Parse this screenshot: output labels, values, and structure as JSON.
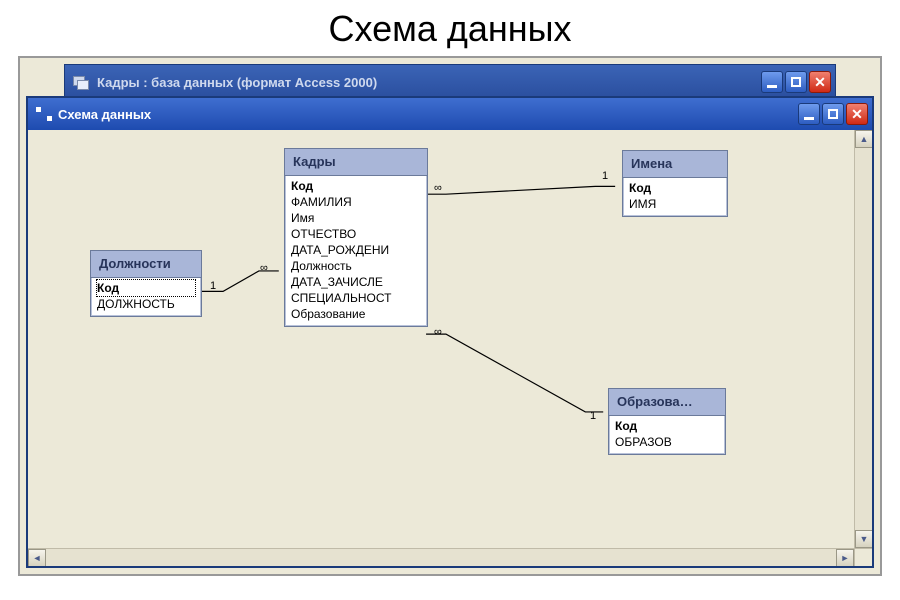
{
  "page_title": "Схема данных",
  "db_window": {
    "title": "Кадры : база данных (формат Access 2000)"
  },
  "schema_window": {
    "title": "Схема данных"
  },
  "tables": {
    "dolzhnosti": {
      "title": "Должности",
      "fields": [
        "Код",
        "ДОЛЖНОСТЬ"
      ]
    },
    "kadry": {
      "title": "Кадры",
      "fields": [
        "Код",
        "ФАМИЛИЯ",
        "Имя",
        "ОТЧЕСТВО",
        "ДАТА_РОЖДЕНИ",
        "Должность",
        "ДАТА_ЗАЧИСЛЕ",
        "СПЕЦИАЛЬНОСТ",
        "Образование"
      ]
    },
    "imena": {
      "title": "Имена",
      "fields": [
        "Код",
        "ИМЯ"
      ]
    },
    "obrazova": {
      "title": "Образова…",
      "fields": [
        "Код",
        "ОБРАЗОВ"
      ]
    }
  },
  "relations": {
    "r1": {
      "left_label": "1",
      "right_label": "∞"
    },
    "r2": {
      "left_label": "∞",
      "right_label": "1"
    },
    "r3": {
      "left_label": "∞",
      "right_label": "1"
    }
  }
}
